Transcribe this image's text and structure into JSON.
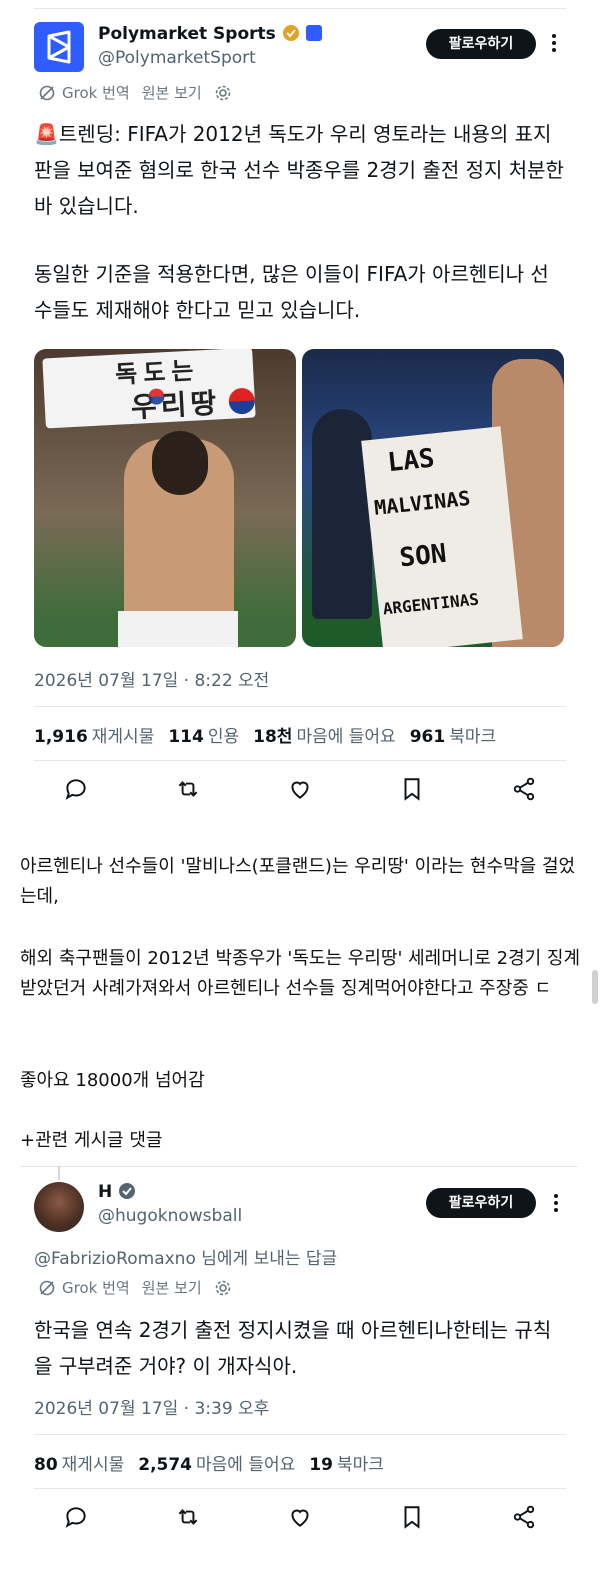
{
  "tweet1": {
    "name": "Polymarket Sports",
    "handle": "@PolymarketSport",
    "follow_label": "팔로우하기",
    "grok_label": "Grok 번역",
    "original_label": "원본 보기",
    "text_para1": "🚨트렌딩: FIFA가 2012년 독도가 우리 영토라는 내용의 표지판을 보여준 혐의로 한국 선수 박종우를 2경기 출전 정지 처분한 바 있습니다.",
    "text_para2": "동일한 기준을 적용한다면, 많은 이들이 FIFA가 아르헨티나 선수들도 제재해야 한다고 믿고 있습니다.",
    "banner_left_top": "독도는",
    "banner_left_bottom": "우리땅",
    "banner_right_1": "LAS",
    "banner_right_2": "MALVINAS",
    "banner_right_3": "SON",
    "banner_right_4": "ARGENTINAS",
    "timestamp": "2026년 07월 17일 · 8:22 오전",
    "stats": {
      "reposts_num": "1,916",
      "reposts_label": "재게시물",
      "quotes_num": "114",
      "quotes_label": "인용",
      "likes_num": "18천",
      "likes_label": "마음에 들어요",
      "bookmarks_num": "961",
      "bookmarks_label": "북마크"
    }
  },
  "post": {
    "p1": "아르헨티나 선수들이 '말비나스(포클랜드)는 우리땅' 이라는 현수막을 걸었는데,",
    "p2": "해외 축구팬들이 2012년 박종우가 '독도는 우리땅' 세레머니로 2경기 징계받았던거 사례가져와서 아르헨티나 선수들 징계먹어야한다고 주장중 ㄷ",
    "p3": "좋아요 18000개 넘어감",
    "p4": "+관련 게시글 댓글"
  },
  "tweet2": {
    "name": "H",
    "handle": "@hugoknowsball",
    "follow_label": "팔로우하기",
    "reply_to": "@FabrizioRomaxno 님에게 보내는 답글",
    "grok_label": "Grok 번역",
    "original_label": "원본 보기",
    "text": "한국을 연속 2경기 출전 정지시켰을 때 아르헨티나한테는 규칙을 구부려준 거야? 이 개자식아.",
    "timestamp": "2026년 07월 17일 · 3:39 오후",
    "stats": {
      "reposts_num": "80",
      "reposts_label": "재게시물",
      "likes_num": "2,574",
      "likes_label": "마음에 들어요",
      "bookmarks_num": "19",
      "bookmarks_label": "북마크"
    }
  },
  "colors": {
    "verified": "#e2a224",
    "follow_bg": "#0f1419",
    "muted": "#536471"
  }
}
